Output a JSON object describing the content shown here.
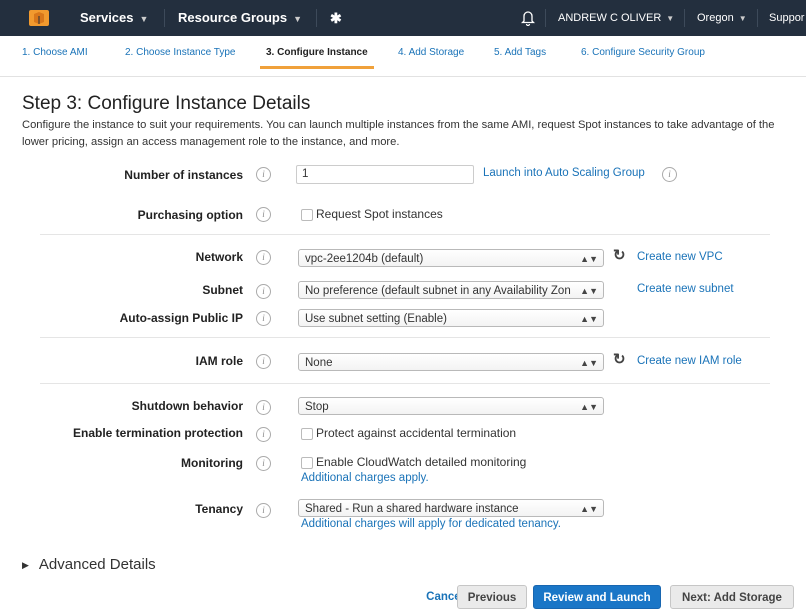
{
  "topbar": {
    "services": "Services",
    "resource_groups": "Resource Groups",
    "user": "ANDREW C OLIVER",
    "region": "Oregon",
    "support": "Suppor"
  },
  "tabs": [
    {
      "label": "1. Choose AMI"
    },
    {
      "label": "2. Choose Instance Type"
    },
    {
      "label": "3. Configure Instance"
    },
    {
      "label": "4. Add Storage"
    },
    {
      "label": "5. Add Tags"
    },
    {
      "label": "6. Configure Security Group"
    }
  ],
  "page": {
    "title": "Step 3: Configure Instance Details",
    "description": "Configure the instance to suit your requirements. You can launch multiple instances from the same AMI, request Spot instances to take advantage of the lower pricing, assign an access management role to the instance, and more."
  },
  "form": {
    "number_of_instances": {
      "label": "Number of instances",
      "value": "1",
      "link": "Launch into Auto Scaling Group"
    },
    "purchasing_option": {
      "label": "Purchasing option",
      "checkbox": "Request Spot instances"
    },
    "network": {
      "label": "Network",
      "value": "vpc-2ee1204b (default)",
      "link": "Create new VPC"
    },
    "subnet": {
      "label": "Subnet",
      "value": "No preference (default subnet in any Availability Zon",
      "link": "Create new subnet"
    },
    "public_ip": {
      "label": "Auto-assign Public IP",
      "value": "Use subnet setting (Enable)"
    },
    "iam_role": {
      "label": "IAM role",
      "value": "None",
      "link": "Create new IAM role"
    },
    "shutdown": {
      "label": "Shutdown behavior",
      "value": "Stop"
    },
    "termination": {
      "label": "Enable termination protection",
      "checkbox": "Protect against accidental termination"
    },
    "monitoring": {
      "label": "Monitoring",
      "checkbox": "Enable CloudWatch detailed monitoring",
      "note": "Additional charges apply."
    },
    "tenancy": {
      "label": "Tenancy",
      "value": "Shared - Run a shared hardware instance",
      "note": "Additional charges will apply for dedicated tenancy."
    }
  },
  "advanced": {
    "label": "Advanced Details"
  },
  "buttons": {
    "cancel": "Cancel",
    "previous": "Previous",
    "review": "Review and Launch",
    "next": "Next: Add Storage"
  }
}
